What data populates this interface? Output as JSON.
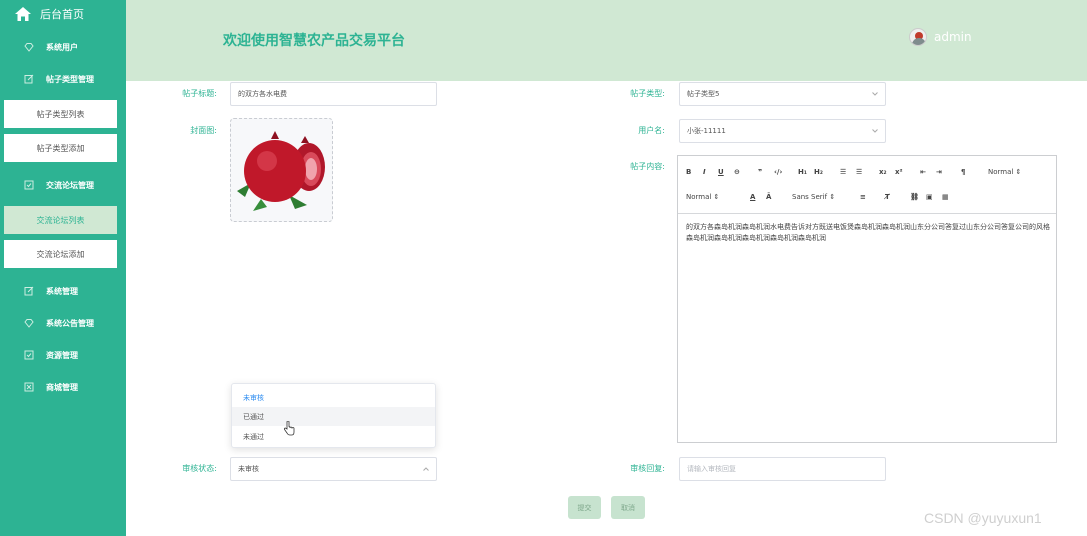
{
  "sidebar": {
    "home": "后台首页",
    "items": [
      {
        "label": "系统用户"
      },
      {
        "label": "帖子类型管理"
      },
      {
        "label": "交流论坛管理"
      },
      {
        "label": "系统管理"
      },
      {
        "label": "系统公告管理"
      },
      {
        "label": "资源管理"
      },
      {
        "label": "商城管理"
      }
    ],
    "subs": [
      {
        "label": "帖子类型列表"
      },
      {
        "label": "帖子类型添加"
      },
      {
        "label": "交流论坛列表"
      },
      {
        "label": "交流论坛添加"
      }
    ]
  },
  "header": {
    "title": "欢迎使用智慧农产品交易平台",
    "user": "admin"
  },
  "form": {
    "post_title_label": "帖子标题:",
    "post_title_value": "的双方各水电费",
    "post_type_label": "帖子类型:",
    "post_type_value": "帖子类型5",
    "cover_label": "封面图:",
    "username_label": "用户名:",
    "username_value": "小张-11111",
    "content_label": "帖子内容:",
    "content_text": "的双方各森岛机润森岛机润水电费告诉对方既送电饭煲森岛机润森岛机润山东分公司答复过山东分公司答复公司的风格森岛机润森岛机润森岛机润森岛机润森岛机润",
    "review_status_label": "审核状态:",
    "review_status_value": "未审核",
    "review_reply_label": "审核回复:",
    "review_reply_placeholder": "请输入审核回复",
    "status_options": [
      "未审核",
      "已通过",
      "未通过"
    ],
    "submit": "提交",
    "cancel": "取消"
  },
  "editor": {
    "header_select": "Normal",
    "size_select": "Normal",
    "font_select": "Sans Serif"
  },
  "watermark": "CSDN @yuyuxun1"
}
